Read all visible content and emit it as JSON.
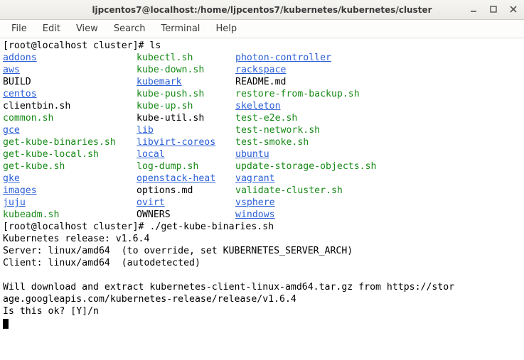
{
  "window": {
    "title": "ljpcentos7@localhost:/home/ljpcentos7/kubernetes/kubernetes/cluster"
  },
  "menubar": {
    "items": [
      "File",
      "Edit",
      "View",
      "Search",
      "Terminal",
      "Help"
    ]
  },
  "terminal": {
    "prompt1": "[root@localhost cluster]# ",
    "cmd1": "ls",
    "ls": {
      "col1": [
        {
          "name": "addons",
          "type": "dir"
        },
        {
          "name": "aws",
          "type": "dir"
        },
        {
          "name": "BUILD",
          "type": "file"
        },
        {
          "name": "centos",
          "type": "dir"
        },
        {
          "name": "clientbin.sh",
          "type": "file"
        },
        {
          "name": "common.sh",
          "type": "exe"
        },
        {
          "name": "gce",
          "type": "dir"
        },
        {
          "name": "get-kube-binaries.sh",
          "type": "exe"
        },
        {
          "name": "get-kube-local.sh",
          "type": "exe"
        },
        {
          "name": "get-kube.sh",
          "type": "exe"
        },
        {
          "name": "gke",
          "type": "dir"
        },
        {
          "name": "images",
          "type": "dir"
        },
        {
          "name": "juju",
          "type": "dir"
        },
        {
          "name": "kubeadm.sh",
          "type": "exe"
        }
      ],
      "col2": [
        {
          "name": "kubectl.sh",
          "type": "exe"
        },
        {
          "name": "kube-down.sh",
          "type": "exe"
        },
        {
          "name": "kubemark",
          "type": "dir"
        },
        {
          "name": "kube-push.sh",
          "type": "exe"
        },
        {
          "name": "kube-up.sh",
          "type": "exe"
        },
        {
          "name": "kube-util.sh",
          "type": "file"
        },
        {
          "name": "lib",
          "type": "dir"
        },
        {
          "name": "libvirt-coreos",
          "type": "dir"
        },
        {
          "name": "local",
          "type": "dir"
        },
        {
          "name": "log-dump.sh",
          "type": "exe"
        },
        {
          "name": "openstack-heat",
          "type": "dir"
        },
        {
          "name": "options.md",
          "type": "file"
        },
        {
          "name": "ovirt",
          "type": "dir"
        },
        {
          "name": "OWNERS",
          "type": "file"
        }
      ],
      "col3": [
        {
          "name": "photon-controller",
          "type": "dir"
        },
        {
          "name": "rackspace",
          "type": "dir"
        },
        {
          "name": "README.md",
          "type": "file"
        },
        {
          "name": "restore-from-backup.sh",
          "type": "exe"
        },
        {
          "name": "skeleton",
          "type": "dir"
        },
        {
          "name": "test-e2e.sh",
          "type": "exe"
        },
        {
          "name": "test-network.sh",
          "type": "exe"
        },
        {
          "name": "test-smoke.sh",
          "type": "exe"
        },
        {
          "name": "ubuntu",
          "type": "dir"
        },
        {
          "name": "update-storage-objects.sh",
          "type": "exe"
        },
        {
          "name": "vagrant",
          "type": "dir"
        },
        {
          "name": "validate-cluster.sh",
          "type": "exe"
        },
        {
          "name": "vsphere",
          "type": "dir"
        },
        {
          "name": "windows",
          "type": "dir"
        }
      ]
    },
    "prompt2": "[root@localhost cluster]# ",
    "cmd2": "./get-kube-binaries.sh",
    "out_release": "Kubernetes release: v1.6.4",
    "out_server": "Server: linux/amd64  (to override, set KUBERNETES_SERVER_ARCH)",
    "out_client": "Client: linux/amd64  (autodetected)",
    "out_blank": "",
    "out_dl1": "Will download and extract kubernetes-client-linux-amd64.tar.gz from https://stor",
    "out_dl2": "age.googleapis.com/kubernetes-release/release/v1.6.4",
    "out_confirm": "Is this ok? [Y]/n"
  }
}
